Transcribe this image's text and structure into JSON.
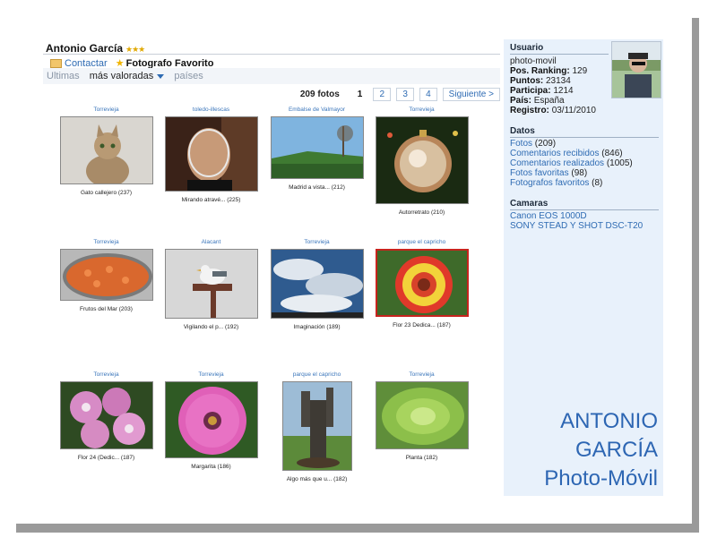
{
  "profile": {
    "name": "Antonio García",
    "stars": "★★★",
    "contact_label": "Contactar",
    "favorite_label": "Fotografo Favorito"
  },
  "tabs": [
    {
      "label": "Ultimas",
      "active": false
    },
    {
      "label": "más valoradas",
      "active": true
    },
    {
      "label": "países",
      "active": false
    }
  ],
  "pager": {
    "count": "209 fotos",
    "pages": [
      "1",
      "2",
      "3",
      "4"
    ],
    "current": "1",
    "next": "Siguiente >"
  },
  "photos": [
    {
      "location": "Torrevieja",
      "caption": "Gato callejero (237)",
      "subject": "cat",
      "favorite": false
    },
    {
      "location": "toledo-illescas",
      "caption": "Mirando atravé... (225)",
      "subject": "glass",
      "favorite": false
    },
    {
      "location": "Embalse de Valmayor",
      "caption": "Madrid a vista... (212)",
      "subject": "landscape",
      "favorite": false
    },
    {
      "location": "Torrevieja",
      "caption": "Autorretrato (210)",
      "subject": "ornament",
      "favorite": false
    },
    {
      "location": "Torrevieja",
      "caption": "Frutos del Mar (203)",
      "subject": "paella",
      "favorite": false
    },
    {
      "location": "Alacant",
      "caption": "Vigilando el p... (192)",
      "subject": "seagull",
      "favorite": false
    },
    {
      "location": "Torrevieja",
      "caption": "Imaginación (189)",
      "subject": "clouds",
      "favorite": false
    },
    {
      "location": "parque el capricho",
      "caption": "Flor 23 Dedica... (187)",
      "subject": "gaillardia",
      "favorite": true
    },
    {
      "location": "Torrevieja",
      "caption": "Flor 24 (Dedic... (187)",
      "subject": "pink-flowers",
      "favorite": false
    },
    {
      "location": "Torrevieja",
      "caption": "Margarita (186)",
      "subject": "daisy",
      "favorite": false
    },
    {
      "location": "parque el capricho",
      "caption": "Algo más que u... (182)",
      "subject": "tree",
      "favorite": false
    },
    {
      "location": "Torrevieja",
      "caption": "Planta (182)",
      "subject": "succulent",
      "favorite": false
    }
  ],
  "sidebar": {
    "user_heading": "Usuario",
    "username": "photo-movil",
    "ranking_label": "Pos. Ranking:",
    "ranking": "129",
    "points_label": "Puntos:",
    "points": "23134",
    "participa_label": "Participa:",
    "participa": "1214",
    "country_label": "País:",
    "country": "España",
    "registro_label": "Registro:",
    "registro": "03/11/2010",
    "data_heading": "Datos",
    "fotos_label": "Fotos",
    "fotos": "(209)",
    "com_rec_label": "Comentarios recibidos",
    "com_rec": "(846)",
    "com_real_label": "Comentarios realizados",
    "com_real": "(1005)",
    "fav_photos_label": "Fotos favoritas",
    "fav_photos": "(98)",
    "fav_photographers_label": "Fotografos favoritos",
    "fav_photographers": "(8)",
    "cameras_heading": "Camaras",
    "cameras": [
      "Canon EOS 1000D",
      "SONY STEAD Y SHOT DSC-T20"
    ]
  },
  "brand": {
    "line1": "ANTONIO",
    "line2": "GARCÍA",
    "line3": "Photo-Móvil"
  },
  "colors": {
    "link": "#2e6bb3",
    "sidebar_bg": "#e8f1fb",
    "favorite_border": "#c7241e"
  }
}
